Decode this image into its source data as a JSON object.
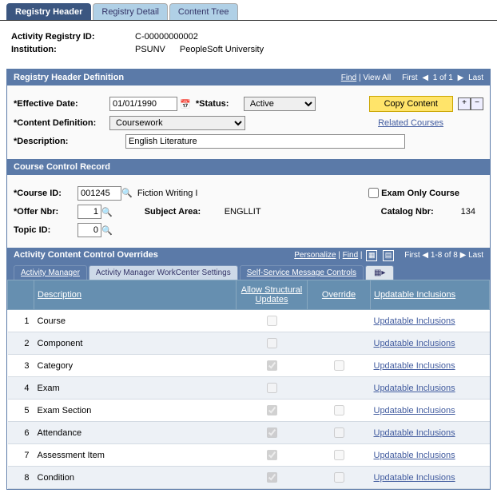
{
  "tabs": [
    "Registry Header",
    "Registry Detail",
    "Content Tree"
  ],
  "info": {
    "activityRegLabel": "Activity Registry ID:",
    "activityRegValue": "C-00000000002",
    "institutionLabel": "Institution:",
    "institutionCode": "PSUNV",
    "institutionName": "PeopleSoft University"
  },
  "regHdr": {
    "title": "Registry Header Definition",
    "find": "Find",
    "viewAll": "View All",
    "first": "First",
    "posText": "1 of 1",
    "last": "Last",
    "effDateLbl": "Effective Date:",
    "effDateVal": "01/01/1990",
    "statusLbl": "Status:",
    "statusVal": "Active",
    "copyBtn": "Copy Content",
    "contentDefLbl": "Content Definition:",
    "contentDefVal": "Coursework",
    "relatedCourses": "Related Courses",
    "descLbl": "Description:",
    "descVal": "English Literature"
  },
  "courseCtrl": {
    "title": "Course Control Record",
    "courseIdLbl": "Course ID:",
    "courseIdVal": "001245",
    "courseName": "Fiction Writing I",
    "examOnlyLbl": "Exam Only Course",
    "offerNbrLbl": "Offer Nbr:",
    "offerNbrVal": "1",
    "subjAreaLbl": "Subject Area:",
    "subjAreaVal": "ENGLLIT",
    "catalogNbrLbl": "Catalog Nbr:",
    "catalogNbrVal": "134",
    "topicIdLbl": "Topic ID:",
    "topicIdVal": "0"
  },
  "acco": {
    "title": "Activity Content Control Overrides",
    "personalize": "Personalize",
    "find": "Find",
    "first": "First",
    "posText": "1-8 of 8",
    "last": "Last",
    "subtabs": [
      "Activity Manager",
      "Activity Manager WorkCenter Settings",
      "Self-Service Message Controls"
    ],
    "cols": {
      "desc": "Description",
      "allow": "Allow Structural Updates",
      "override": "Override",
      "updatable": "Updatable Inclusions"
    },
    "rows": [
      {
        "n": "1",
        "desc": "Course",
        "allowChecked": false,
        "override": false,
        "link": "Updatable Inclusions"
      },
      {
        "n": "2",
        "desc": "Component",
        "allowChecked": false,
        "override": false,
        "link": "Updatable Inclusions"
      },
      {
        "n": "3",
        "desc": "Category",
        "allowChecked": true,
        "override": true,
        "link": "Updatable Inclusions"
      },
      {
        "n": "4",
        "desc": "Exam",
        "allowChecked": false,
        "override": false,
        "link": "Updatable Inclusions"
      },
      {
        "n": "5",
        "desc": "Exam Section",
        "allowChecked": true,
        "override": true,
        "link": "Updatable Inclusions"
      },
      {
        "n": "6",
        "desc": "Attendance",
        "allowChecked": true,
        "override": true,
        "link": "Updatable Inclusions"
      },
      {
        "n": "7",
        "desc": "Assessment Item",
        "allowChecked": true,
        "override": true,
        "link": "Updatable Inclusions"
      },
      {
        "n": "8",
        "desc": "Condition",
        "allowChecked": true,
        "override": true,
        "link": "Updatable Inclusions"
      }
    ]
  }
}
